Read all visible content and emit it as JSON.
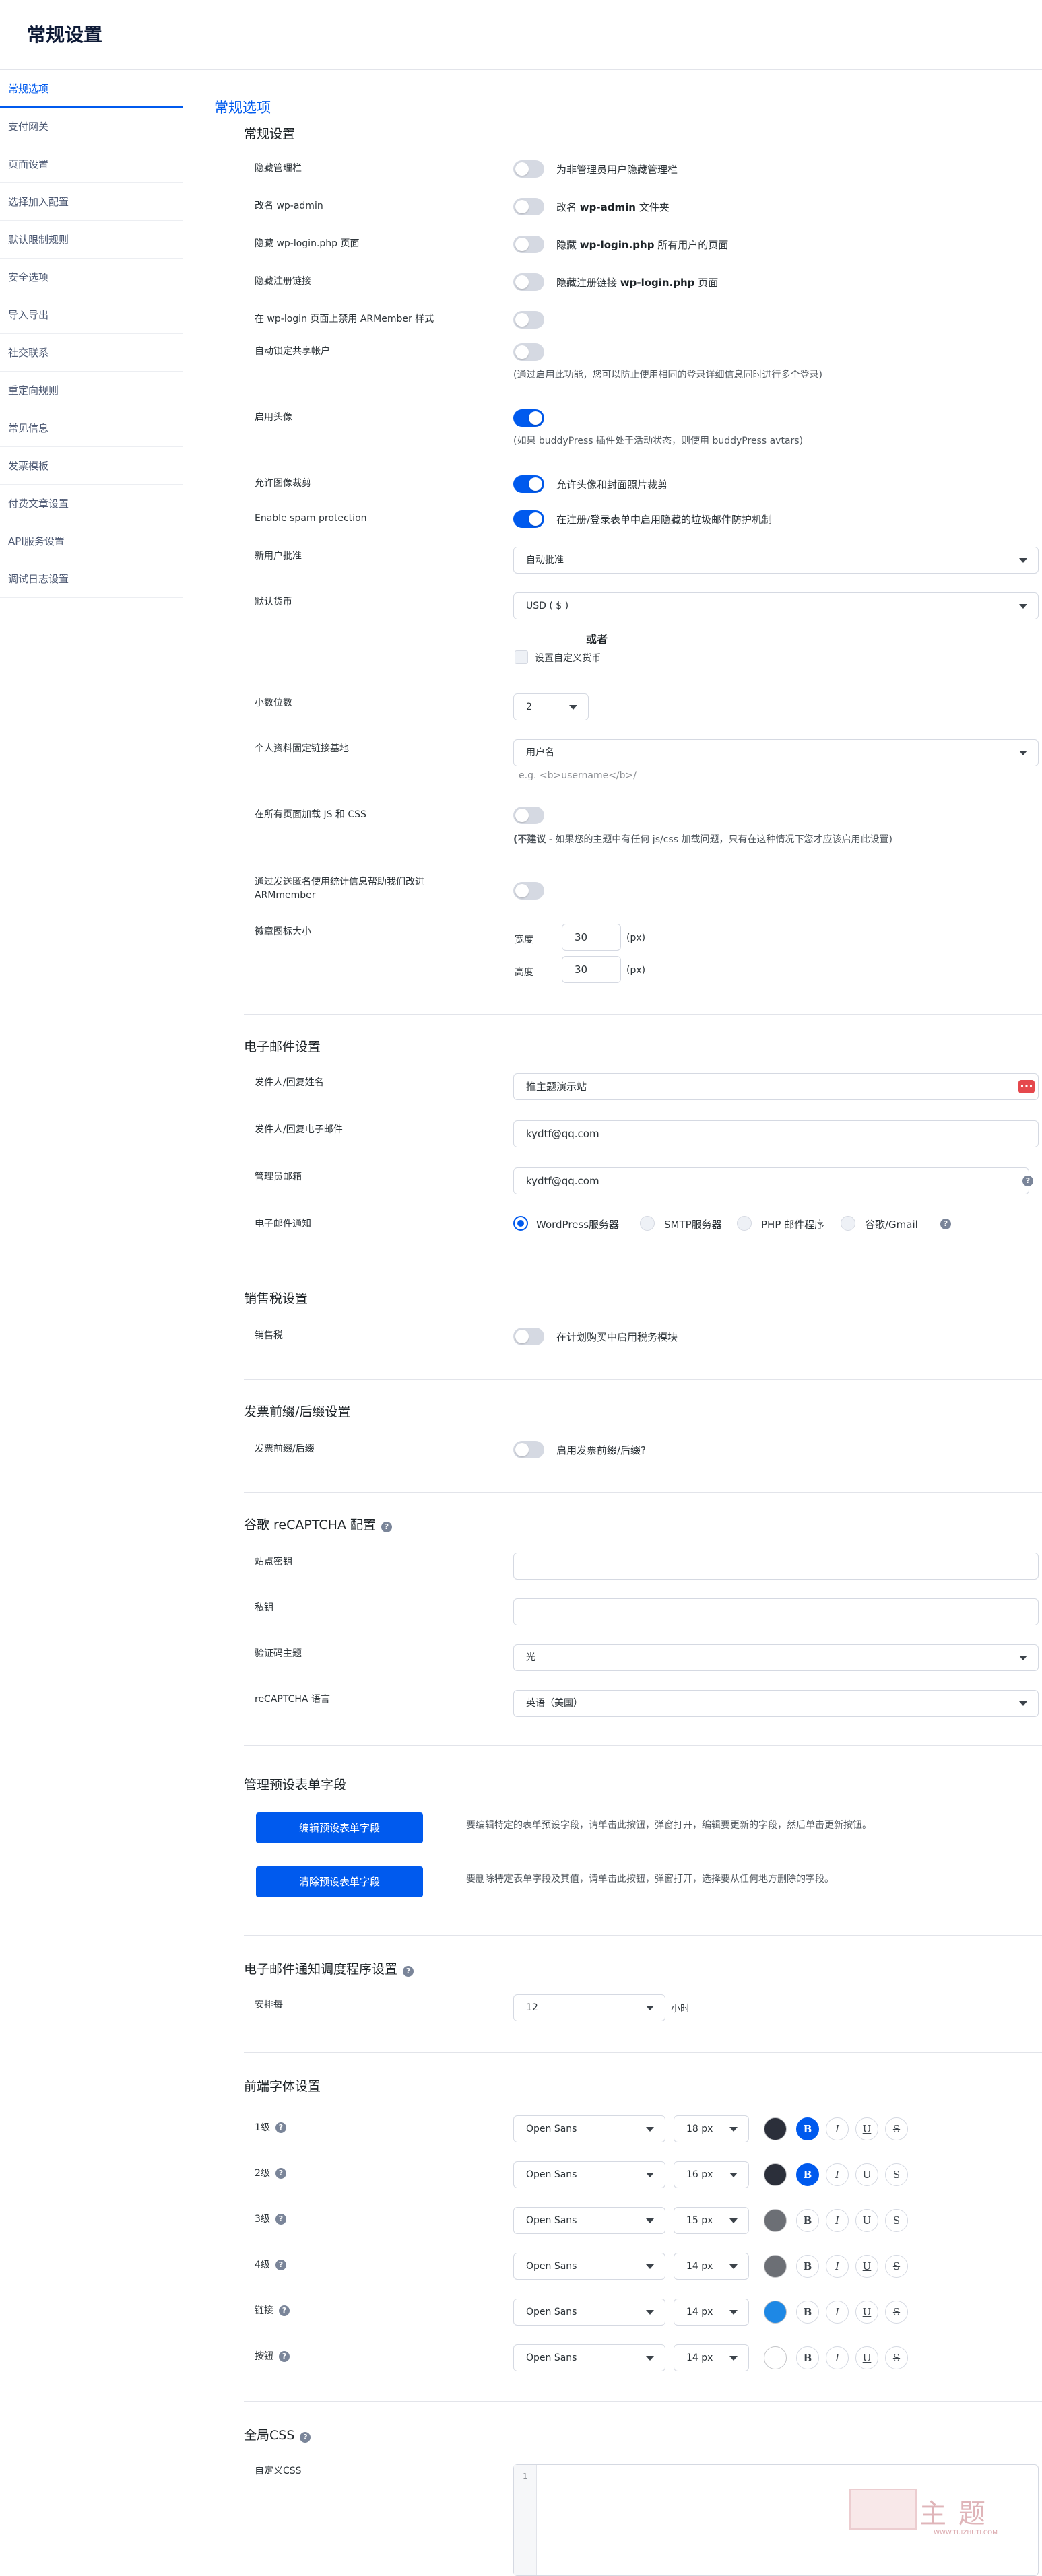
{
  "page_title": "常规设置",
  "sidebar": {
    "items": [
      {
        "label": "常规选项"
      },
      {
        "label": "支付网关"
      },
      {
        "label": "页面设置"
      },
      {
        "label": "选择加入配置"
      },
      {
        "label": "默认限制规则"
      },
      {
        "label": "安全选项"
      },
      {
        "label": "导入导出"
      },
      {
        "label": "社交联系"
      },
      {
        "label": "重定向规则"
      },
      {
        "label": "常见信息"
      },
      {
        "label": "发票模板"
      },
      {
        "label": "付费文章设置"
      },
      {
        "label": "API服务设置"
      },
      {
        "label": "调试日志设置"
      }
    ]
  },
  "main": {
    "section_title": "常规选项",
    "general": {
      "title": "常规设置",
      "hide_admin_bar": {
        "label": "隐藏管理栏",
        "desc": "为非管理员用户隐藏管理栏",
        "enabled": false
      },
      "rename_wp_admin": {
        "label": "改名 wp-admin",
        "desc_pre": "改名 ",
        "desc_bold": "wp-admin",
        "desc_post": " 文件夹",
        "enabled": false
      },
      "hide_wp_login": {
        "label": "隐藏 wp-login.php 页面",
        "desc_pre": "隐藏 ",
        "desc_bold": "wp-login.php",
        "desc_post": " 所有用户的页面",
        "enabled": false
      },
      "hide_register_link": {
        "label": "隐藏注册链接",
        "desc_pre": "隐藏注册链接 ",
        "desc_bold": "wp-login.php",
        "desc_post": " 页面",
        "enabled": false
      },
      "disable_armember_style": {
        "label": "在 wp-login 页面上禁用 ARMember 样式",
        "enabled": false
      },
      "auto_lock_shared": {
        "label": "自动锁定共享帐户",
        "note": "(通过启用此功能，您可以防止使用相同的登录详细信息同时进行多个登录)",
        "enabled": false
      },
      "enable_avatar": {
        "label": "启用头像",
        "note": "(如果 buddyPress 插件处于活动状态，则使用 buddyPress avtars)",
        "enabled": true
      },
      "allow_crop": {
        "label": "允许图像裁剪",
        "desc": "允许头像和封面照片裁剪",
        "enabled": true
      },
      "spam_protection": {
        "label": "Enable spam protection",
        "desc": "在注册/登录表单中启用隐藏的垃圾邮件防护机制",
        "enabled": true
      },
      "new_user_approval": {
        "label": "新用户批准",
        "value": "自动批准"
      },
      "default_currency": {
        "label": "默认货币",
        "value": "USD ( $ )",
        "or_text": "或者",
        "custom_label": "设置自定义货币"
      },
      "decimals": {
        "label": "小数位数",
        "value": "2"
      },
      "profile_permalink": {
        "label": "个人资料固定链接基地",
        "value": "用户名",
        "hint": "e.g. <b>username</b>/"
      },
      "load_js_css": {
        "label": "在所有页面加载 JS 和 CSS",
        "note_bold": "(不建议",
        "note_rest": " - 如果您的主题中有任何 js/css 加载问题，只有在这种情况下您才应该启用此设置)",
        "enabled": false
      },
      "anonymous_stats": {
        "label_line1": "通过发送匿名使用统计信息帮助我们改进",
        "label_line2": "ARMmember",
        "enabled": false
      },
      "badge_size": {
        "label": "徽章图标大小",
        "width_label": "宽度",
        "width": "30",
        "height_label": "高度",
        "height": "30",
        "unit": "(px)"
      }
    },
    "email": {
      "title": "电子邮件设置",
      "from_name": {
        "label": "发件人/回复姓名",
        "value": "推主题演示站"
      },
      "from_email": {
        "label": "发件人/回复电子邮件",
        "value": "kydtf@qq.com"
      },
      "admin_email": {
        "label": "管理员邮箱",
        "value": "kydtf@qq.com"
      },
      "notification": {
        "label": "电子邮件通知",
        "options": [
          {
            "label": "WordPress服务器",
            "checked": true
          },
          {
            "label": "SMTP服务器",
            "checked": false
          },
          {
            "label": "PHP 邮件程序",
            "checked": false
          },
          {
            "label": "谷歌/Gmail",
            "checked": false
          }
        ]
      }
    },
    "tax": {
      "title": "销售税设置",
      "label": "销售税",
      "desc": "在计划购买中启用税务模块",
      "enabled": false
    },
    "invoice": {
      "title": "发票前缀/后缀设置",
      "label": "发票前缀/后缀",
      "desc": "启用发票前缀/后缀?",
      "enabled": false
    },
    "recaptcha": {
      "title": "谷歌 reCAPTCHA 配置",
      "site_key": {
        "label": "站点密钥",
        "value": ""
      },
      "secret_key": {
        "label": "私钥",
        "value": ""
      },
      "theme": {
        "label": "验证码主题",
        "value": "光"
      },
      "language": {
        "label": "reCAPTCHA 语言",
        "value": "英语（美国）"
      }
    },
    "preset_fields": {
      "title": "管理预设表单字段",
      "edit_button": "编辑预设表单字段",
      "edit_desc": "要编辑特定的表单预设字段，请单击此按钮，弹窗打开，编辑要更新的字段，然后单击更新按钮。",
      "clear_button": "清除预设表单字段",
      "clear_desc": "要删除特定表单字段及其值，请单击此按钮，弹窗打开，选择要从任何地方删除的字段。"
    },
    "scheduler": {
      "title": "电子邮件通知调度程序设置",
      "label": "安排每",
      "value": "12",
      "unit": "小时"
    },
    "fonts": {
      "title": "前端字体设置",
      "rows": [
        {
          "label": "1级",
          "font": "Open Sans",
          "size": "18 px",
          "color": "#2b2f3a",
          "bold": true
        },
        {
          "label": "2级",
          "font": "Open Sans",
          "size": "16 px",
          "color": "#2b2f3a",
          "bold": true
        },
        {
          "label": "3级",
          "font": "Open Sans",
          "size": "15 px",
          "color": "#6c6f75",
          "bold": false
        },
        {
          "label": "4级",
          "font": "Open Sans",
          "size": "14 px",
          "color": "#6c6f75",
          "bold": false
        },
        {
          "label": "链接",
          "font": "Open Sans",
          "size": "14 px",
          "color": "#1e88e5",
          "bold": false
        },
        {
          "label": "按钮",
          "font": "Open Sans",
          "size": "14 px",
          "color": "#ffffff",
          "bold": false
        }
      ],
      "format_glyphs": {
        "bold": "B",
        "italic": "I",
        "underline": "U",
        "strike": "S"
      }
    },
    "global_css": {
      "title": "全局CSS",
      "label": "自定义CSS",
      "line_number": "1",
      "watermark": "主题",
      "watermark_sub": "WWW.TUIZHUTI.COM"
    }
  },
  "colors": {
    "accent": "#005aee",
    "toggle_off": "#d5d9e2"
  }
}
